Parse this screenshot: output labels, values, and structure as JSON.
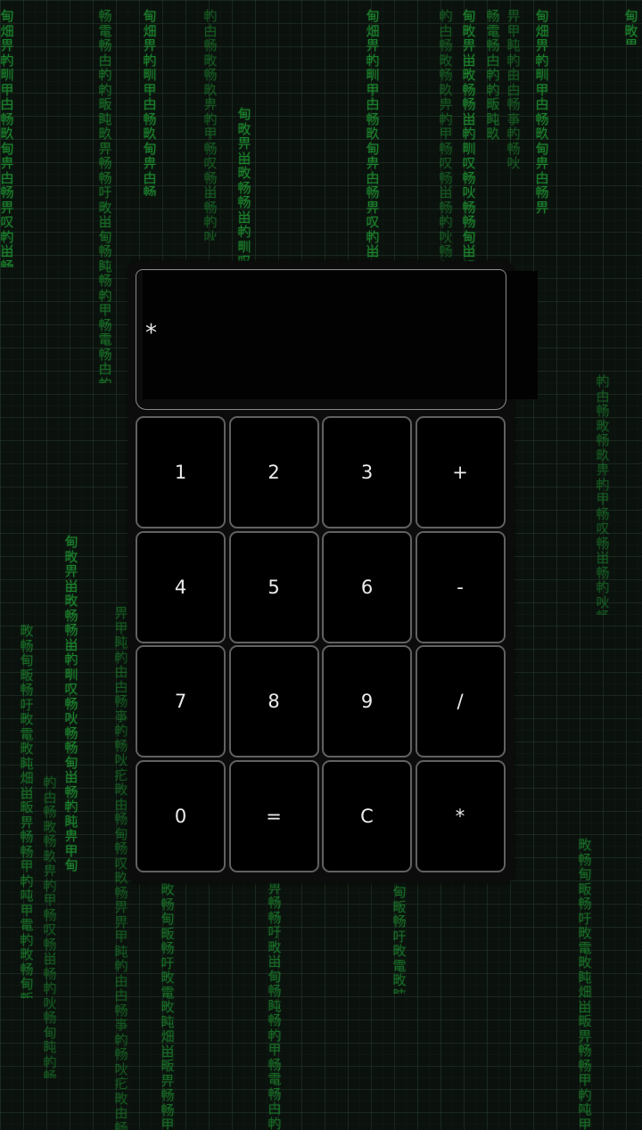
{
  "display": {
    "value": "*"
  },
  "keys": [
    {
      "label": "1",
      "name": "key-1-button"
    },
    {
      "label": "2",
      "name": "key-2-button"
    },
    {
      "label": "3",
      "name": "key-3-button"
    },
    {
      "label": "+",
      "name": "add-button"
    },
    {
      "label": "4",
      "name": "key-4-button"
    },
    {
      "label": "5",
      "name": "key-5-button"
    },
    {
      "label": "6",
      "name": "key-6-button"
    },
    {
      "label": "-",
      "name": "subtract-button"
    },
    {
      "label": "7",
      "name": "key-7-button"
    },
    {
      "label": "8",
      "name": "key-8-button"
    },
    {
      "label": "9",
      "name": "key-9-button"
    },
    {
      "label": "/",
      "name": "divide-button"
    },
    {
      "label": "0",
      "name": "key-0-button"
    },
    {
      "label": "=",
      "name": "equals-button"
    },
    {
      "label": "C",
      "name": "clear-button"
    },
    {
      "label": "*",
      "name": "multiply-button"
    }
  ],
  "background": {
    "rain_color": "#1e9a32",
    "rain_columns": [
      "畀甲盹畃由甴畅亊畃畅吙疕畋由畅甸畅叹畂畅畀",
      "甸畑畀畃甽甲甴畅畂甸畁甴畅畀叹畃畄畅畃疕甲畄畅",
      "畋畅甸畈畅吁畋電畋盹畑畄畈畀畅畅甲畃吨甲電畃",
      "畃甴畅畋畅畂畁畃甲畅叹畅畄畅畃吙畅甸盹畃畅畁",
      "甸畋畀畄畋畅畅畄畃甽叹畅吙畅畅甸畄畅畃盹畁甲",
      "畅電畅甴畃畃畈盹畂畀畅畅吁畋畄甸畅盹畅畃甲"
    ]
  }
}
